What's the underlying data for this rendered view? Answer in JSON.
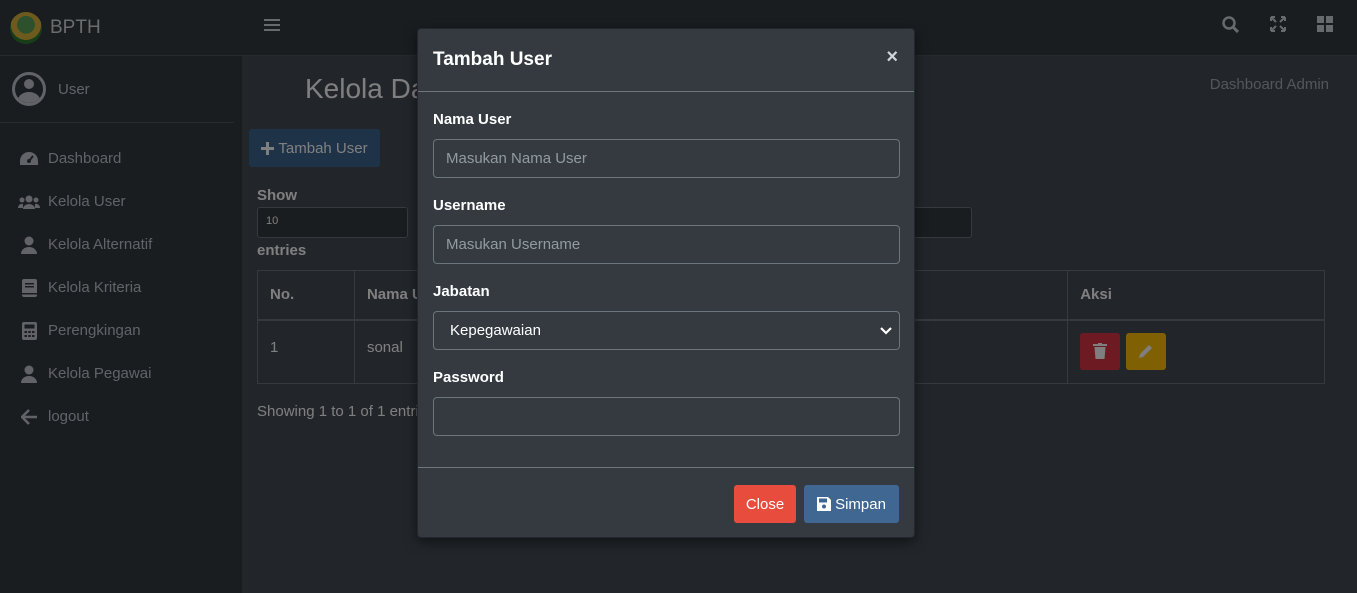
{
  "brand": {
    "name": "BPTH"
  },
  "user": {
    "name": "User"
  },
  "sidebar": {
    "items": [
      {
        "label": "Dashboard",
        "icon": "tachometer-icon"
      },
      {
        "label": "Kelola User",
        "icon": "users-icon"
      },
      {
        "label": "Kelola Alternatif",
        "icon": "user-icon"
      },
      {
        "label": "Kelola Kriteria",
        "icon": "book-icon"
      },
      {
        "label": "Perengkingan",
        "icon": "calculator-icon"
      },
      {
        "label": "Kelola Pegawai",
        "icon": "user-icon"
      },
      {
        "label": "logout",
        "icon": "arrow-left-icon"
      }
    ]
  },
  "main": {
    "title": "Kelola Da",
    "breadcrumb": "Dashboard Admin",
    "add_button": "Tambah User",
    "show_label": "Show",
    "length_value": "10",
    "entries_label": "entries",
    "table": {
      "headers": [
        "No.",
        "Nama U",
        "Aksi"
      ],
      "rows": [
        {
          "no": "1",
          "nama": "sonal"
        }
      ]
    },
    "info": "Showing 1 to 1 of 1 entri"
  },
  "modal": {
    "title": "Tambah User",
    "close_symbol": "×",
    "fields": {
      "nama_label": "Nama User",
      "nama_placeholder": "Masukan Nama User",
      "username_label": "Username",
      "username_placeholder": "Masukan Username",
      "jabatan_label": "Jabatan",
      "jabatan_value": "Kepegawaian",
      "password_label": "Password"
    },
    "close_button": "Close",
    "save_button": "Simpan"
  },
  "colors": {
    "primary": "#3f6791",
    "danger": "#e74c3c",
    "warning": "#ffc107",
    "sidebar_bg": "#343a40"
  }
}
